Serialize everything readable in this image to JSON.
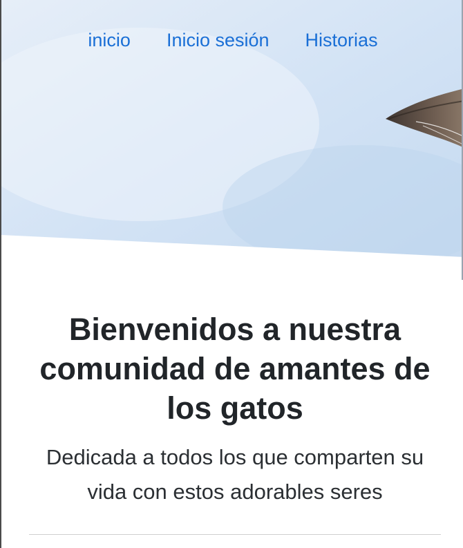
{
  "nav": {
    "items": [
      {
        "label": "inicio"
      },
      {
        "label": "Inicio sesión"
      },
      {
        "label": "Historias"
      }
    ]
  },
  "hero": {
    "image_name": "cat-ear-background-image"
  },
  "main": {
    "title": "Bienvenidos a nuestra comunidad de amantes de los gatos",
    "subtitle": "Dedicada a todos los que comparten su vida con estos adorables seres"
  },
  "colors": {
    "link": "#1a6fd6",
    "sky": "#d6e6f7",
    "text": "#212529"
  }
}
